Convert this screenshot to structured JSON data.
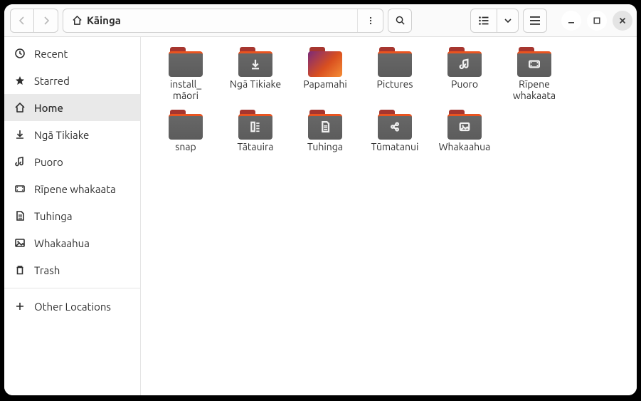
{
  "path": {
    "current": "Kāinga"
  },
  "sidebar": {
    "items": [
      {
        "label": "Recent",
        "icon": "clock"
      },
      {
        "label": "Starred",
        "icon": "star"
      },
      {
        "label": "Home",
        "icon": "home",
        "active": true
      },
      {
        "label": "Ngā Tikiake",
        "icon": "download"
      },
      {
        "label": "Puoro",
        "icon": "music"
      },
      {
        "label": "Rīpene whakaata",
        "icon": "video"
      },
      {
        "label": "Tuhinga",
        "icon": "document"
      },
      {
        "label": "Whakaahua",
        "icon": "image"
      },
      {
        "label": "Trash",
        "icon": "trash"
      }
    ],
    "other": {
      "label": "Other Locations",
      "icon": "plus"
    }
  },
  "grid": {
    "items": [
      {
        "label": "install_\nmāori",
        "variant": "grey",
        "glyph": ""
      },
      {
        "label": "Ngā Tikiake",
        "variant": "grey",
        "glyph": "download"
      },
      {
        "label": "Papamahi",
        "variant": "orange",
        "glyph": ""
      },
      {
        "label": "Pictures",
        "variant": "grey",
        "glyph": ""
      },
      {
        "label": "Puoro",
        "variant": "grey",
        "glyph": "music"
      },
      {
        "label": "Rīpene whakaata",
        "variant": "grey",
        "glyph": "video"
      },
      {
        "label": "snap",
        "variant": "grey",
        "glyph": ""
      },
      {
        "label": "Tātauira",
        "variant": "grey",
        "glyph": "template"
      },
      {
        "label": "Tuhinga",
        "variant": "grey",
        "glyph": "document"
      },
      {
        "label": "Tūmatanui",
        "variant": "grey",
        "glyph": "share"
      },
      {
        "label": "Whakaahua",
        "variant": "grey",
        "glyph": "image"
      }
    ]
  }
}
